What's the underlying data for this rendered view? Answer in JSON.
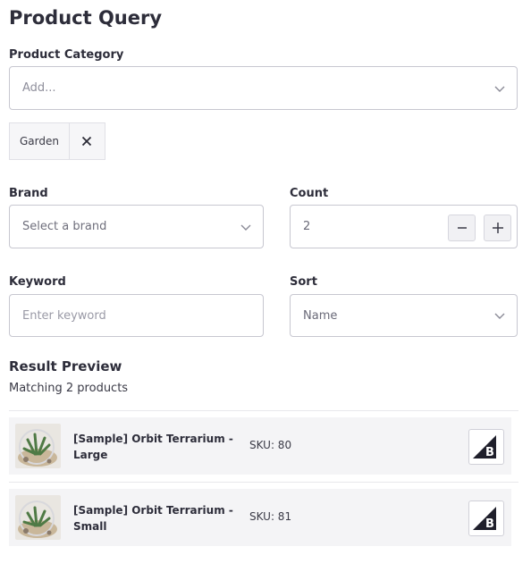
{
  "page": {
    "title": "Product Query"
  },
  "category": {
    "label": "Product Category",
    "placeholder": "Add...",
    "selected_chip": "Garden"
  },
  "brand": {
    "label": "Brand",
    "placeholder": "Select a brand"
  },
  "count": {
    "label": "Count",
    "value": "2"
  },
  "keyword": {
    "label": "Keyword",
    "placeholder": "Enter keyword"
  },
  "sort": {
    "label": "Sort",
    "value": "Name"
  },
  "results": {
    "title": "Result Preview",
    "summary": "Matching 2 products",
    "items": [
      {
        "name": "[Sample] Orbit Terrarium - Large",
        "sku": "SKU: 80",
        "icon": "bigcommerce-logo-icon"
      },
      {
        "name": "[Sample] Orbit Terrarium - Small",
        "sku": "SKU: 81",
        "icon": "bigcommerce-logo-icon"
      }
    ]
  },
  "colors": {
    "text": "#2d2d3a",
    "border": "#c7c7d0",
    "row_bg": "#f4f4f6"
  }
}
